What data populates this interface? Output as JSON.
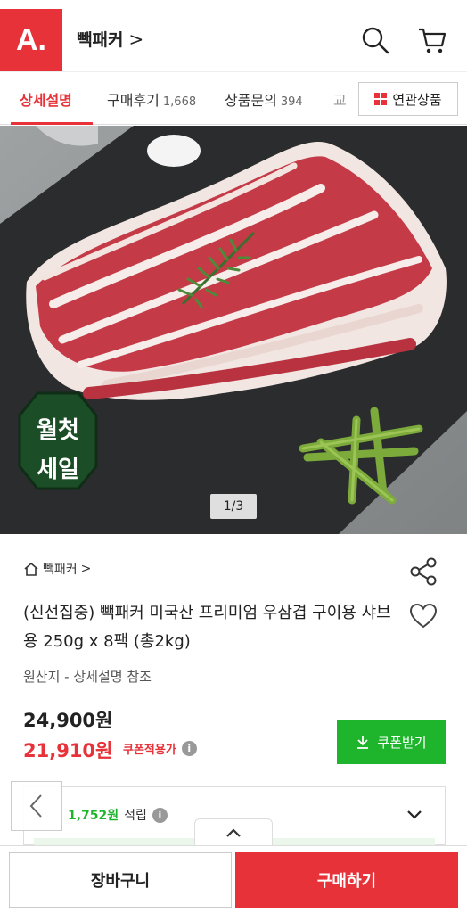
{
  "header": {
    "logo_text": "A.",
    "store_name": "빽패커",
    "store_chevron": ">"
  },
  "tabs": [
    {
      "label": "상세설명",
      "count": ""
    },
    {
      "label": "구매후기",
      "count": "1,668"
    },
    {
      "label": "상품문의",
      "count": "394"
    },
    {
      "label": "교",
      "count": ""
    }
  ],
  "related_button": {
    "label": "연관상품"
  },
  "hero": {
    "badge_lines": [
      "월첫",
      "세일"
    ],
    "counter": "1/3"
  },
  "product": {
    "breadcrumb": "빽패커",
    "breadcrumb_chevron": ">",
    "title": "(신선집중) 빽패커 미국산 프리미엄 우삼겹 구이용 샤브용 250g x 8팩 (총2kg)",
    "origin": "원산지 - 상세설명 참조",
    "original_price": "24,900원",
    "sale_price": "21,910원",
    "coupon_note": "쿠폰적용가",
    "info_glyph": "i",
    "coupon_button": "쿠폰받기"
  },
  "reward": {
    "amount": "1,752원",
    "label": "적립"
  },
  "bottom": {
    "cart_label": "장바구니",
    "buy_label": "구매하기"
  },
  "colors": {
    "brand_red": "#e63238",
    "coupon_green": "#1eb52d"
  }
}
